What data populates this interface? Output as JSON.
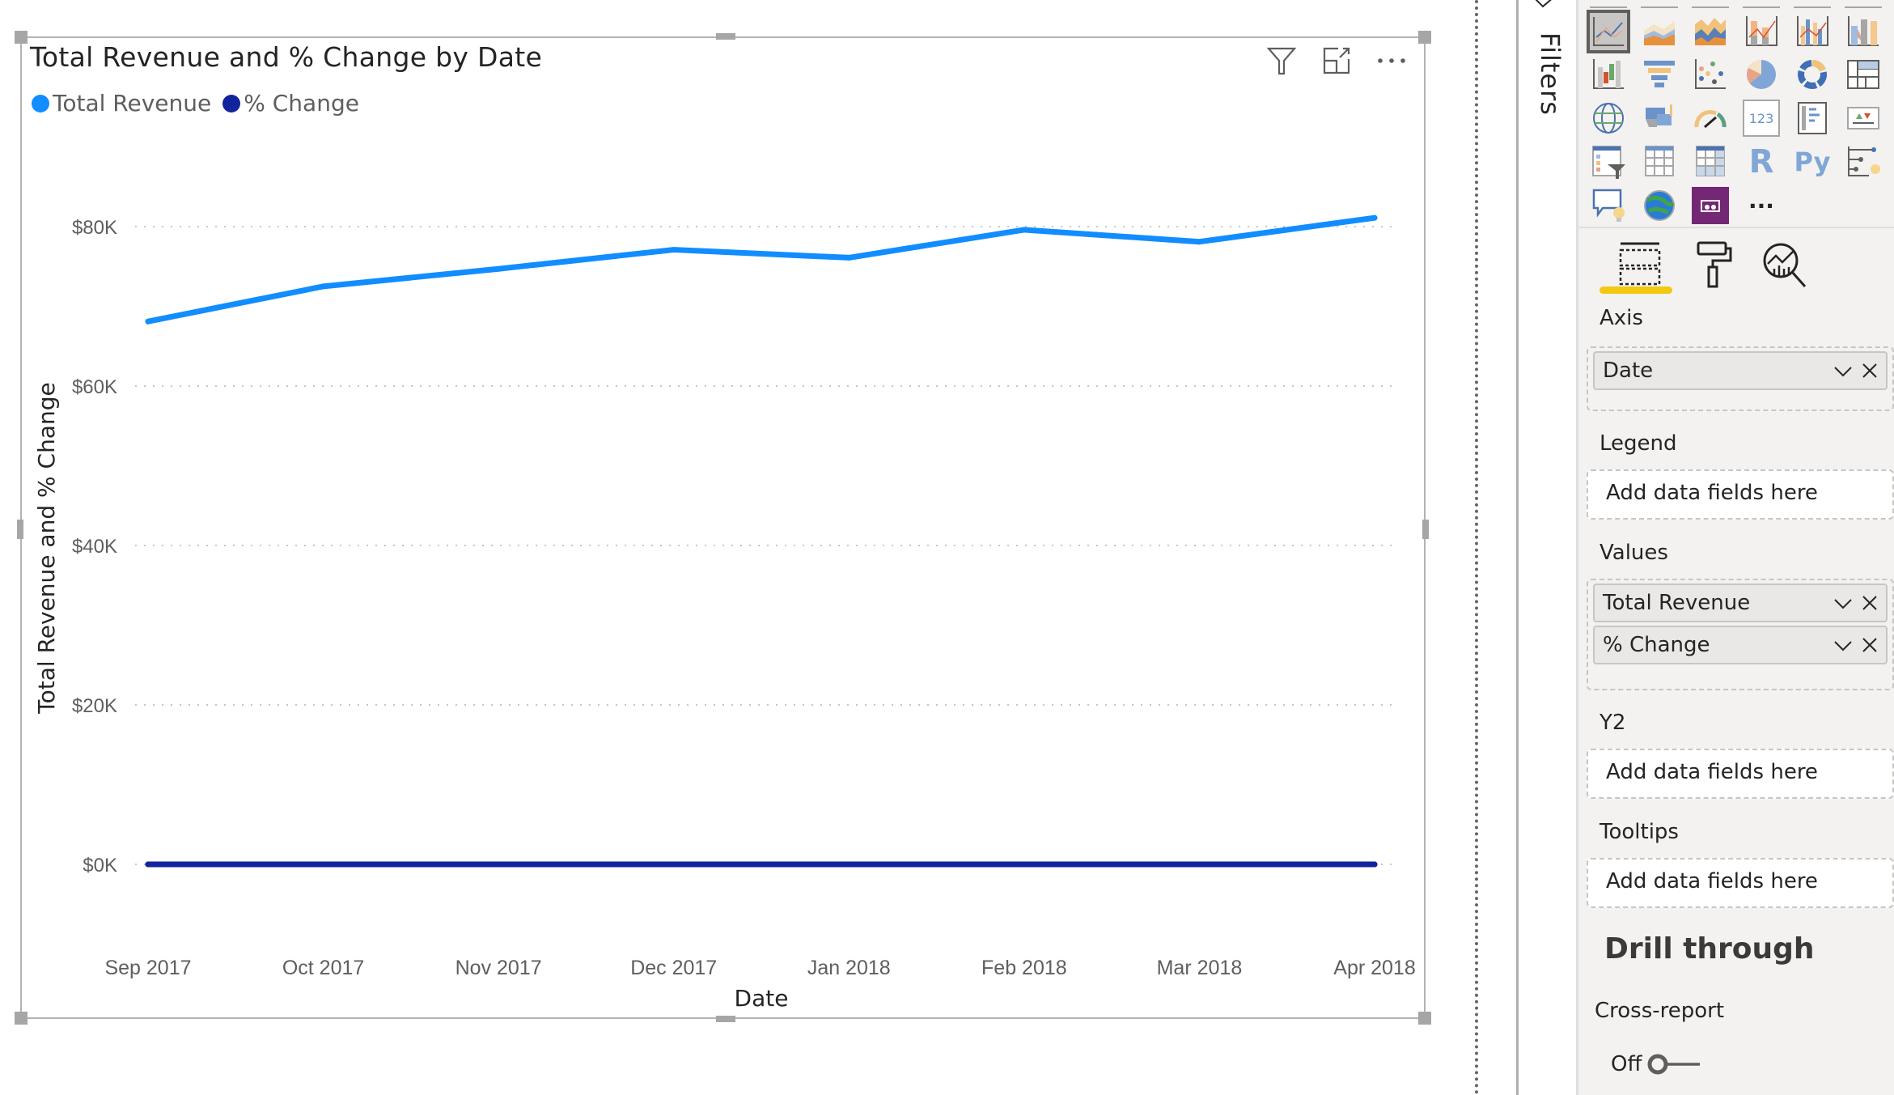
{
  "visual": {
    "title": "Total Revenue and % Change by Date",
    "header_icons": [
      "filter-icon",
      "focus-mode-icon",
      "more-options-icon"
    ],
    "legend": [
      {
        "label": "Total Revenue",
        "color": "#118DFF"
      },
      {
        "label": "% Change",
        "color": "#12239E"
      }
    ]
  },
  "chart_data": {
    "type": "line",
    "title": "Total Revenue and % Change by Date",
    "xlabel": "Date",
    "ylabel": "Total Revenue and % Change",
    "categories": [
      "Sep 2017",
      "Oct 2017",
      "Nov 2017",
      "Dec 2017",
      "Jan 2018",
      "Feb 2018",
      "Mar 2018",
      "Apr 2018"
    ],
    "series": [
      {
        "name": "Total Revenue",
        "color": "#118DFF",
        "values": [
          68100,
          72500,
          74700,
          77100,
          76100,
          79600,
          78100,
          81100
        ]
      },
      {
        "name": "% Change",
        "color": "#12239E",
        "values": [
          0,
          0,
          0,
          0,
          0,
          0,
          0,
          0
        ]
      }
    ],
    "yticks": [
      {
        "value": 0,
        "label": "$0K"
      },
      {
        "value": 20000,
        "label": "$20K"
      },
      {
        "value": 40000,
        "label": "$40K"
      },
      {
        "value": 60000,
        "label": "$60K"
      },
      {
        "value": 80000,
        "label": "$80K"
      }
    ],
    "ylim": [
      0,
      88000
    ],
    "grid": true,
    "legend_position": "top-left"
  },
  "filters_pane": {
    "label": "Filters"
  },
  "viz_pane": {
    "gallery": [
      {
        "name": "line-chart-icon",
        "selected": true
      },
      {
        "name": "area-chart-icon"
      },
      {
        "name": "stacked-area-chart-icon"
      },
      {
        "name": "line-and-stacked-column-chart-icon"
      },
      {
        "name": "line-and-clustered-column-chart-icon"
      },
      {
        "name": "ribbon-chart-icon"
      },
      {
        "name": "waterfall-chart-icon"
      },
      {
        "name": "funnel-chart-icon"
      },
      {
        "name": "scatter-chart-icon"
      },
      {
        "name": "pie-chart-icon"
      },
      {
        "name": "donut-chart-icon"
      },
      {
        "name": "treemap-icon"
      },
      {
        "name": "map-icon"
      },
      {
        "name": "filled-map-icon"
      },
      {
        "name": "gauge-icon"
      },
      {
        "name": "card-icon",
        "text": "123"
      },
      {
        "name": "multi-row-card-icon"
      },
      {
        "name": "kpi-icon"
      },
      {
        "name": "slicer-icon"
      },
      {
        "name": "table-icon"
      },
      {
        "name": "matrix-icon"
      },
      {
        "name": "r-script-visual-icon",
        "text": "R"
      },
      {
        "name": "python-visual-icon",
        "text": "Py"
      },
      {
        "name": "key-influencers-icon"
      },
      {
        "name": "qa-visual-icon"
      },
      {
        "name": "arcgis-map-icon"
      },
      {
        "name": "power-apps-icon"
      },
      {
        "name": "more-visuals-icon",
        "text": "···"
      }
    ],
    "tabs": [
      "fields-tab",
      "format-tab",
      "analytics-tab"
    ],
    "wells": {
      "axis": {
        "label": "Axis",
        "fields": [
          "Date"
        ]
      },
      "legend": {
        "label": "Legend",
        "placeholder": "Add data fields here"
      },
      "values": {
        "label": "Values",
        "fields": [
          "Total Revenue",
          "% Change"
        ]
      },
      "y2": {
        "label": "Y2",
        "placeholder": "Add data fields here"
      },
      "tooltips": {
        "label": "Tooltips",
        "placeholder": "Add data fields here"
      }
    },
    "drill_through": {
      "title": "Drill through",
      "cross_report_label": "Cross-report",
      "toggle_state": "Off"
    }
  }
}
